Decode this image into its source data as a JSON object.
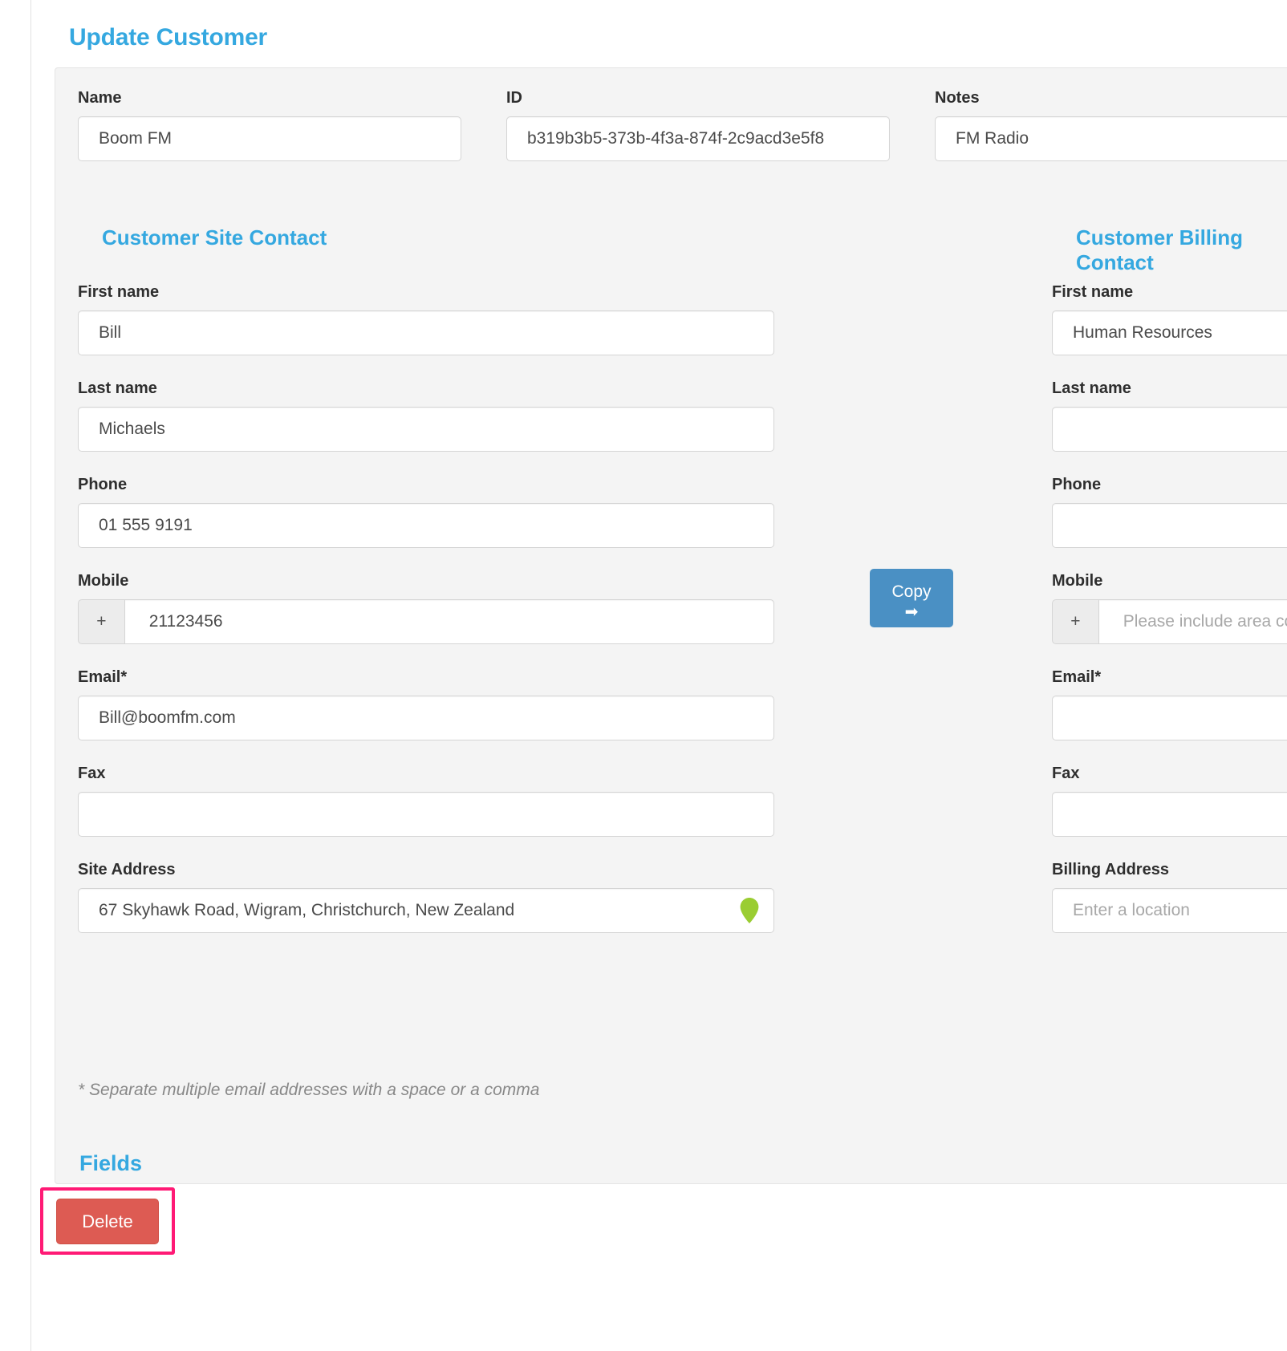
{
  "page": {
    "title": "Update Customer"
  },
  "top_fields": [
    {
      "label": "Name",
      "value": "Boom FM",
      "placeholder": ""
    },
    {
      "label": "ID",
      "value": "b319b3b5-373b-4f3a-874f-2c9acd3e5f8",
      "placeholder": ""
    },
    {
      "label": "Notes",
      "value": "FM Radio",
      "placeholder": ""
    }
  ],
  "site_contact": {
    "heading": "Customer Site Contact",
    "fields": {
      "first_name": {
        "label": "First name",
        "value": "Bill",
        "placeholder": ""
      },
      "last_name": {
        "label": "Last name",
        "value": "Michaels",
        "placeholder": ""
      },
      "phone": {
        "label": "Phone",
        "value": "01 555 9191",
        "placeholder": ""
      },
      "mobile": {
        "label": "Mobile",
        "value": "21123456",
        "placeholder": "",
        "prefix": "+"
      },
      "email": {
        "label": "Email*",
        "value": "Bill@boomfm.com",
        "placeholder": ""
      },
      "fax": {
        "label": "Fax",
        "value": "",
        "placeholder": ""
      },
      "address": {
        "label": "Site Address",
        "value": "67 Skyhawk Road, Wigram, Christchurch, New Zealand",
        "placeholder": "Enter a location"
      }
    }
  },
  "billing_contact": {
    "heading": "Customer Billing Contact",
    "fields": {
      "first_name": {
        "label": "First name",
        "value": "Human Resources",
        "placeholder": ""
      },
      "last_name": {
        "label": "Last name",
        "value": "",
        "placeholder": ""
      },
      "phone": {
        "label": "Phone",
        "value": "",
        "placeholder": ""
      },
      "mobile": {
        "label": "Mobile",
        "value": "",
        "placeholder": "Please include area code",
        "prefix": "+"
      },
      "email": {
        "label": "Email*",
        "value": "",
        "placeholder": ""
      },
      "fax": {
        "label": "Fax",
        "value": "",
        "placeholder": ""
      },
      "address": {
        "label": "Billing Address",
        "value": "",
        "placeholder": "Enter a location"
      }
    }
  },
  "copy": {
    "label": "Copy",
    "arrow": "➡"
  },
  "footnote": "* Separate multiple email addresses with a space or a comma",
  "fields_section": {
    "heading": "Fields"
  },
  "delete": {
    "label": "Delete"
  },
  "colors": {
    "accent": "#35a8e0",
    "panel_bg": "#f4f4f4",
    "copy_button": "#4a90c4",
    "delete_button": "#dd5b53",
    "highlight": "#ff1a75",
    "pin": "#9acd32"
  }
}
